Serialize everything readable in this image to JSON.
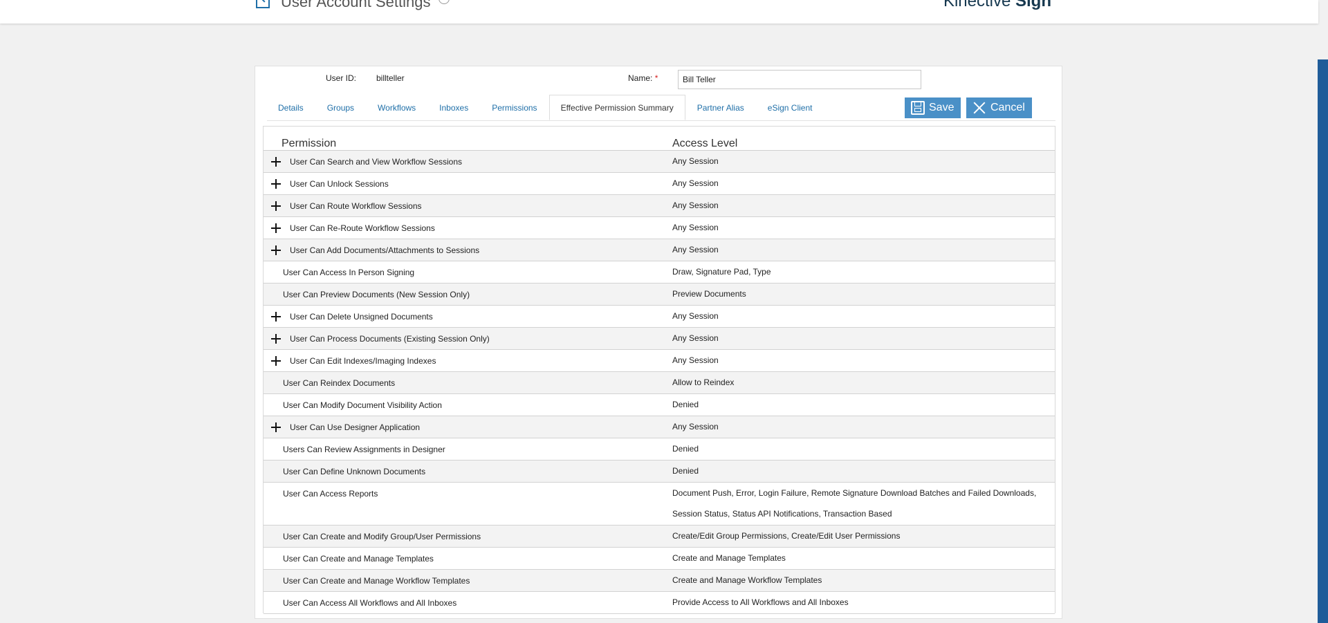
{
  "header": {
    "title": "User Account Settings",
    "brand_light": "Kinective ",
    "brand_bold": "Sign"
  },
  "form": {
    "user_id_label": "User ID:",
    "user_id_value": "billteller",
    "name_label": "Name:",
    "required_mark": "*",
    "name_value": "Bill Teller"
  },
  "tabs": [
    {
      "label": "Details"
    },
    {
      "label": "Groups"
    },
    {
      "label": "Workflows"
    },
    {
      "label": "Inboxes"
    },
    {
      "label": "Permissions"
    },
    {
      "label": "Effective Permission Summary",
      "active": true
    },
    {
      "label": "Partner Alias"
    },
    {
      "label": "eSign Client"
    }
  ],
  "buttons": {
    "save": "Save",
    "cancel": "Cancel"
  },
  "table": {
    "col_permission": "Permission",
    "col_access": "Access Level",
    "rows": [
      {
        "permission": "User Can Search and View Workflow Sessions",
        "access": "Any Session",
        "expandable": true
      },
      {
        "permission": "User Can Unlock Sessions",
        "access": "Any Session",
        "expandable": true
      },
      {
        "permission": "User Can Route Workflow Sessions",
        "access": "Any Session",
        "expandable": true
      },
      {
        "permission": "User Can Re-Route Workflow Sessions",
        "access": "Any Session",
        "expandable": true
      },
      {
        "permission": "User Can Add Documents/Attachments to Sessions",
        "access": "Any Session",
        "expandable": true
      },
      {
        "permission": "User Can Access In Person Signing",
        "access": "Draw, Signature Pad, Type",
        "expandable": false
      },
      {
        "permission": "User Can Preview Documents (New Session Only)",
        "access": "Preview Documents",
        "expandable": false
      },
      {
        "permission": "User Can Delete Unsigned Documents",
        "access": "Any Session",
        "expandable": true
      },
      {
        "permission": "User Can Process Documents (Existing Session Only)",
        "access": "Any Session",
        "expandable": true
      },
      {
        "permission": "User Can Edit Indexes/Imaging Indexes",
        "access": "Any Session",
        "expandable": true
      },
      {
        "permission": "User Can Reindex Documents",
        "access": "Allow to Reindex",
        "expandable": false
      },
      {
        "permission": "User Can Modify Document Visibility Action",
        "access": "Denied",
        "expandable": false
      },
      {
        "permission": "User Can Use Designer Application",
        "access": "Any Session",
        "expandable": true
      },
      {
        "permission": "Users Can Review Assignments in Designer",
        "access": "Denied",
        "expandable": false
      },
      {
        "permission": "User Can Define Unknown Documents",
        "access": "Denied",
        "expandable": false
      },
      {
        "permission": "User Can Access Reports",
        "access": "Document Push, Error, Login Failure, Remote Signature Download Batches and Failed Downloads, Session Status, Status API Notifications, Transaction Based",
        "expandable": false,
        "tall": true
      },
      {
        "permission": "User Can Create and Modify Group/User Permissions",
        "access": "Create/Edit Group Permissions, Create/Edit User Permissions",
        "expandable": false
      },
      {
        "permission": "User Can Create and Manage Templates",
        "access": "Create and Manage Templates",
        "expandable": false
      },
      {
        "permission": "User Can Create and Manage Workflow Templates",
        "access": "Create and Manage Workflow Templates",
        "expandable": false
      },
      {
        "permission": "User Can Access All Workflows and All Inboxes",
        "access": "Provide Access to All Workflows and All Inboxes",
        "expandable": false
      }
    ]
  }
}
